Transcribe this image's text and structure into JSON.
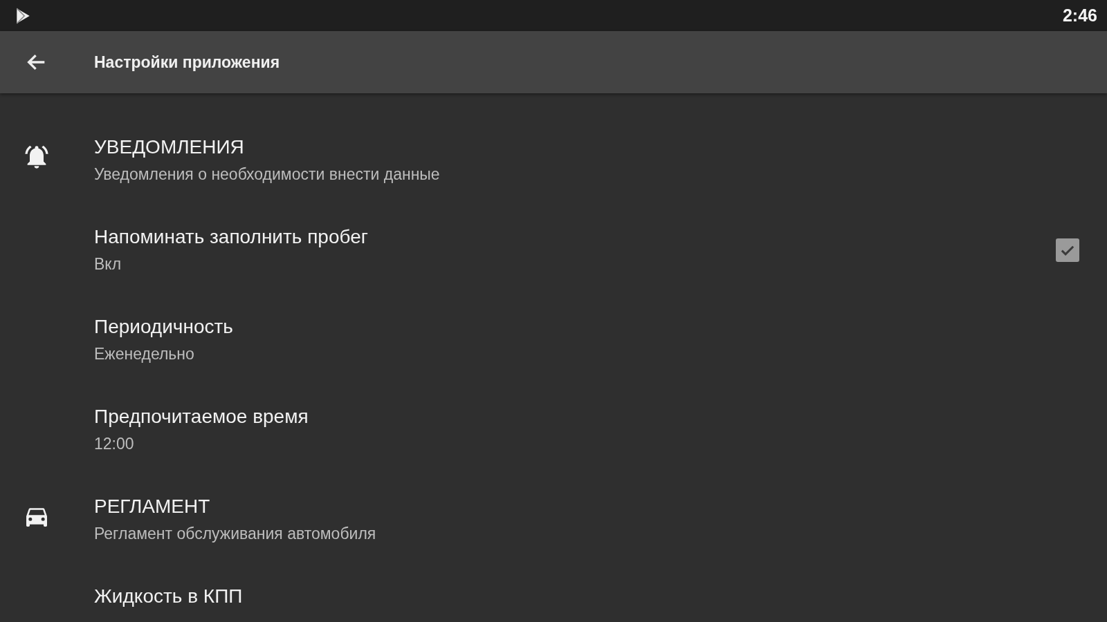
{
  "status_bar": {
    "time": "2:46"
  },
  "toolbar": {
    "title": "Настройки приложения"
  },
  "items": [
    {
      "kind": "category",
      "title": "УВЕДОМЛЕНИЯ",
      "summary": "Уведомления о необходимости внести данные"
    },
    {
      "kind": "checkbox",
      "title": "Напоминать заполнить пробег",
      "summary": "Вкл",
      "checked": true
    },
    {
      "kind": "preference",
      "title": "Периодичность",
      "summary": "Еженедельно"
    },
    {
      "kind": "preference",
      "title": "Предпочитаемое время",
      "summary": "12:00"
    },
    {
      "kind": "category",
      "title": "РЕГЛАМЕНТ",
      "summary": "Регламент обслуживания автомобиля"
    },
    {
      "kind": "preference",
      "title": "Жидкость в КПП"
    }
  ]
}
